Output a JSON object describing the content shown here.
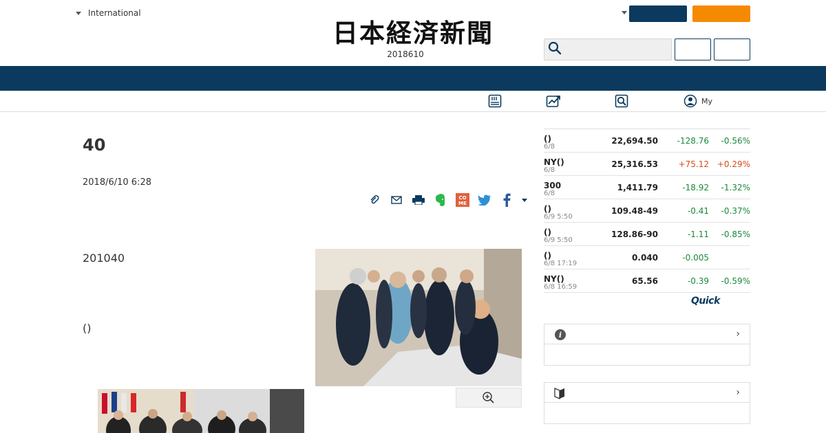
{
  "header": {
    "edition_label": "International",
    "logo_text": "日本経済新聞",
    "date": "2018610",
    "search_placeholder": ""
  },
  "subnav": {
    "mypage_label": "My"
  },
  "article": {
    "title": "40",
    "published": "2018/6/10 6:28",
    "paragraph1": "201040",
    "paragraph2": "()"
  },
  "share_icons": [
    "clip-icon",
    "mail-icon",
    "print-icon",
    "evernote-icon",
    "come-icon",
    "twitter-icon",
    "facebook-icon",
    "chevron-down-icon"
  ],
  "market": {
    "rows": [
      {
        "name": "()",
        "time": "6/8",
        "value": "22,694.50",
        "change": "-128.76",
        "pct": "-0.56%",
        "dir": "down"
      },
      {
        "name": "NY()",
        "time": "6/8",
        "value": "25,316.53",
        "change": "+75.12",
        "pct": "+0.29%",
        "dir": "up"
      },
      {
        "name": "300",
        "time": "6/8",
        "value": "1,411.79",
        "change": "-18.92",
        "pct": "-1.32%",
        "dir": "down"
      },
      {
        "name": "()",
        "time": "6/9 5:50",
        "value": "109.48-49",
        "change": "-0.41",
        "pct": "-0.37%",
        "dir": "down"
      },
      {
        "name": "()",
        "time": "6/9 5:50",
        "value": "128.86-90",
        "change": "-1.11",
        "pct": "-0.85%",
        "dir": "down"
      },
      {
        "name": "()",
        "time": "6/8 17:19",
        "value": "0.040",
        "change": "-0.005",
        "pct": "",
        "dir": "down"
      },
      {
        "name": "NY()",
        "time": "6/8 16:59",
        "value": "65.56",
        "change": "-0.39",
        "pct": "-0.59%",
        "dir": "down"
      }
    ],
    "provider": "Quick"
  },
  "colors": {
    "navy": "#0b3a5e",
    "orange": "#f58a00",
    "down": "#1a8a3a",
    "up": "#d94a16"
  },
  "zoom_icon": "zoom-in-icon"
}
